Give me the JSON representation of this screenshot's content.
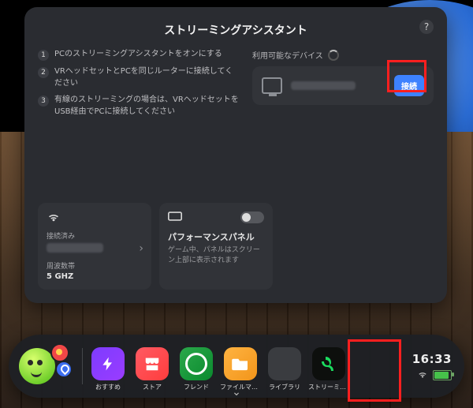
{
  "panel": {
    "title": "ストリーミングアシスタント",
    "steps": [
      {
        "n": "1",
        "text": "PCのストリーミングアシスタントをオンにする"
      },
      {
        "n": "2",
        "text": "VRヘッドセットとPCを同じルーターに接続してください"
      },
      {
        "n": "3",
        "text": "有線のストリーミングの場合は、VRヘッドセットをUSB経由でPCに接続してください"
      }
    ],
    "devices": {
      "heading": "利用可能なデバイス",
      "connect_label": "接続"
    },
    "wifi_card": {
      "status_label": "接続済み",
      "freq_label": "周波数帯",
      "freq_value": "5 GHZ"
    },
    "perf_card": {
      "title": "パフォーマンスパネル",
      "desc": "ゲーム中、パネルはスクリーン上部に表示されます",
      "toggle": false
    }
  },
  "dock": {
    "apps": [
      {
        "id": "recommended",
        "label": "おすすめ"
      },
      {
        "id": "store",
        "label": "ストア"
      },
      {
        "id": "friends",
        "label": "フレンド"
      },
      {
        "id": "files",
        "label": "ファイルマネ…"
      },
      {
        "id": "library",
        "label": "ライブラリ"
      },
      {
        "id": "streaming",
        "label": "ストリーミング…"
      }
    ],
    "clock": "16:33"
  }
}
